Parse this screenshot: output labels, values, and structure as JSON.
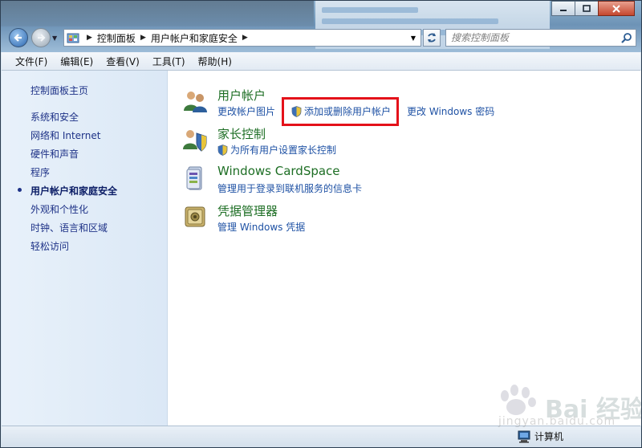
{
  "window": {
    "caption_buttons": [
      "minimize-icon",
      "maximize-icon",
      "close-icon"
    ]
  },
  "address_bar": {
    "breadcrumbs": [
      "控制面板",
      "用户帐户和家庭安全"
    ]
  },
  "search": {
    "placeholder": "搜索控制面板"
  },
  "menu": {
    "items": [
      "文件(F)",
      "编辑(E)",
      "查看(V)",
      "工具(T)",
      "帮助(H)"
    ]
  },
  "sidebar": {
    "home": "控制面板主页",
    "items": [
      {
        "label": "系统和安全",
        "active": false
      },
      {
        "label": "网络和 Internet",
        "active": false
      },
      {
        "label": "硬件和声音",
        "active": false
      },
      {
        "label": "程序",
        "active": false
      },
      {
        "label": "用户帐户和家庭安全",
        "active": true
      },
      {
        "label": "外观和个性化",
        "active": false
      },
      {
        "label": "时钟、语言和区域",
        "active": false
      },
      {
        "label": "轻松访问",
        "active": false
      }
    ]
  },
  "categories": [
    {
      "title": "用户帐户",
      "icon": "user-accounts-icon",
      "links": [
        {
          "label": "更改帐户图片",
          "shield": false
        },
        {
          "label": "添加或删除用户帐户",
          "shield": true
        },
        {
          "label": "更改 Windows 密码",
          "shield": false
        }
      ]
    },
    {
      "title": "家长控制",
      "icon": "parental-controls-icon",
      "links": [
        {
          "label": "为所有用户设置家长控制",
          "shield": true
        }
      ]
    },
    {
      "title": "Windows CardSpace",
      "icon": "cardspace-icon",
      "links": [
        {
          "label": "管理用于登录到联机服务的信息卡",
          "shield": false
        }
      ]
    },
    {
      "title": "凭据管理器",
      "icon": "credential-manager-icon",
      "links": [
        {
          "label": "管理 Windows 凭据",
          "shield": false
        }
      ]
    }
  ],
  "status_bar": {
    "computer": "计算机"
  },
  "watermark": {
    "brand": "Bai 经验",
    "domain": "jingyan.baidu.com"
  },
  "colors": {
    "link": "#1e51a4",
    "category_title": "#1d6e24",
    "highlight": "#e4121a"
  }
}
